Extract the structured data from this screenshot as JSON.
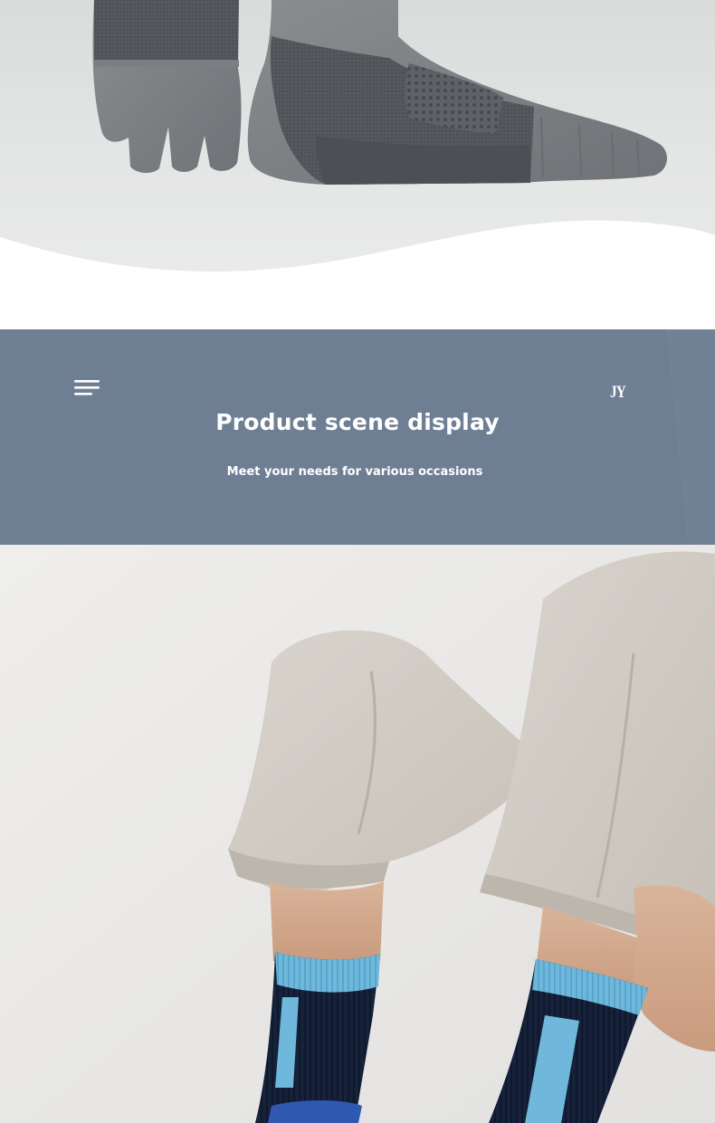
{
  "banner": {
    "title": "Product scene display",
    "subtitle": "Meet your needs for various occasions",
    "brand_logo": "JY",
    "menu_icon": "menu-lines-icon",
    "background_color": "#718195"
  },
  "photos": {
    "top": "toe-socks-product-photo",
    "bottom": "person-wearing-crew-socks-photo"
  }
}
